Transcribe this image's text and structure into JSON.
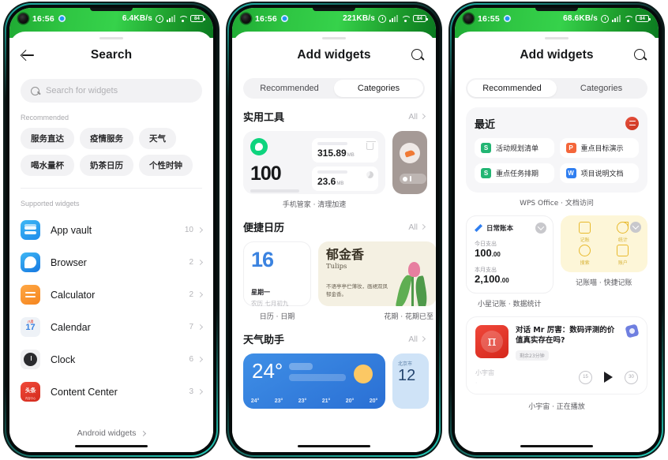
{
  "screens": [
    {
      "id": "search",
      "status": {
        "time": "16:56",
        "net_speed": "6.4KB/s",
        "battery": "84"
      },
      "nav": {
        "title": "Search",
        "back_icon": "back-arrow-icon"
      },
      "search": {
        "placeholder": "Search for widgets",
        "value": ""
      },
      "recommended": {
        "label": "Recommended",
        "chips": [
          "服务直达",
          "疫情服务",
          "天气",
          "喝水量杯",
          "奶茶日历",
          "个性时钟"
        ]
      },
      "supported": {
        "label": "Supported widgets",
        "apps": [
          {
            "name": "App vault",
            "count": "10",
            "icon": "app-vault-icon"
          },
          {
            "name": "Browser",
            "count": "2",
            "icon": "browser-icon"
          },
          {
            "name": "Calculator",
            "count": "2",
            "icon": "calculator-icon"
          },
          {
            "name": "Calendar",
            "count": "7",
            "icon": "calendar-icon",
            "cal_top": "八月",
            "cal_day": "17"
          },
          {
            "name": "Clock",
            "count": "6",
            "icon": "clock-icon"
          },
          {
            "name": "Content Center",
            "count": "3",
            "icon": "content-center-icon",
            "badge": "头条",
            "badge_sub": "内容中心"
          }
        ]
      },
      "footer_link": "Android widgets"
    },
    {
      "id": "add-widgets-categories",
      "status": {
        "time": "16:56",
        "net_speed": "221KB/s",
        "battery": "84"
      },
      "nav": {
        "title": "Add widgets",
        "search_icon": "search-icon"
      },
      "tabs": [
        {
          "label": "Recommended",
          "active": false
        },
        {
          "label": "Categories",
          "active": true
        }
      ],
      "sections": [
        {
          "title": "实用工具",
          "all": "All",
          "manager": {
            "score": "100",
            "tile1_value": "315.89",
            "tile1_unit": "MB",
            "tile1_icon": "trash-icon",
            "tile2_value": "23.6",
            "tile2_unit": "MB",
            "tile2_icon": "pie-icon",
            "caption": "手机管家 · 清理加速"
          }
        },
        {
          "title": "便捷日历",
          "all": "All",
          "calendar": {
            "day": "16",
            "weekday": "星期一",
            "lunar": "农历 七月初九",
            "caption": "日历 · 日期"
          },
          "tulip": {
            "title": "郁金香",
            "subtitle": "Tulips",
            "poem": "不语亭亭伫薄妆，画裙双凤郁金香。",
            "caption": "花期 · 花期已至"
          }
        },
        {
          "title": "天气助手",
          "all": "All",
          "weather": {
            "temp": "24°",
            "hours": [
              "24°",
              "23°",
              "23°",
              "21°",
              "20°",
              "20°"
            ]
          },
          "weather2": {
            "city": "北京市",
            "temp": "12"
          }
        }
      ]
    },
    {
      "id": "add-widgets-recommended",
      "status": {
        "time": "16:55",
        "net_speed": "68.6KB/s",
        "battery": "84"
      },
      "nav": {
        "title": "Add widgets",
        "search_icon": "search-icon"
      },
      "tabs": [
        {
          "label": "Recommended",
          "active": true
        },
        {
          "label": "Categories",
          "active": false
        }
      ],
      "recent": {
        "title": "最近",
        "badge_icon": "wps-logo-icon",
        "docs": [
          {
            "label": "活动规划清单",
            "type": "S",
            "color": "#22b573"
          },
          {
            "label": "重点目标演示",
            "type": "P",
            "color": "#f4663a"
          },
          {
            "label": "重点任务排期",
            "type": "S",
            "color": "#22b573"
          },
          {
            "label": "项目说明文档",
            "type": "W",
            "color": "#2f7ef0"
          }
        ],
        "caption": "WPS Office · 文档访问"
      },
      "ledger": {
        "name": "日常账本",
        "today_label": "今日支出",
        "today_value": "100",
        "today_cents": ".00",
        "month_label": "本月支出",
        "month_value": "2,100",
        "month_cents": ".00",
        "caption": "小星记账 · 数据统计",
        "download_icon": "download-icon"
      },
      "quick": {
        "cells": [
          {
            "label": "记账",
            "icon": "edit-icon"
          },
          {
            "label": "统计",
            "icon": "pie-chart-icon"
          },
          {
            "label": "搜索",
            "icon": "search-icon"
          },
          {
            "label": "账户",
            "icon": "wallet-icon"
          }
        ],
        "caption": "记账喵 · 快捷记账",
        "download_icon": "download-icon"
      },
      "podcast": {
        "title": "对话 Mr 厉害：数码评测的价值真实存在吗?",
        "remaining": "剩余23分钟",
        "source": "小宇宙",
        "logo": "pi-icon",
        "rewind": "15",
        "forward": "30",
        "play_icon": "play-icon",
        "caption": "小宇宙 · 正在播放"
      }
    }
  ]
}
